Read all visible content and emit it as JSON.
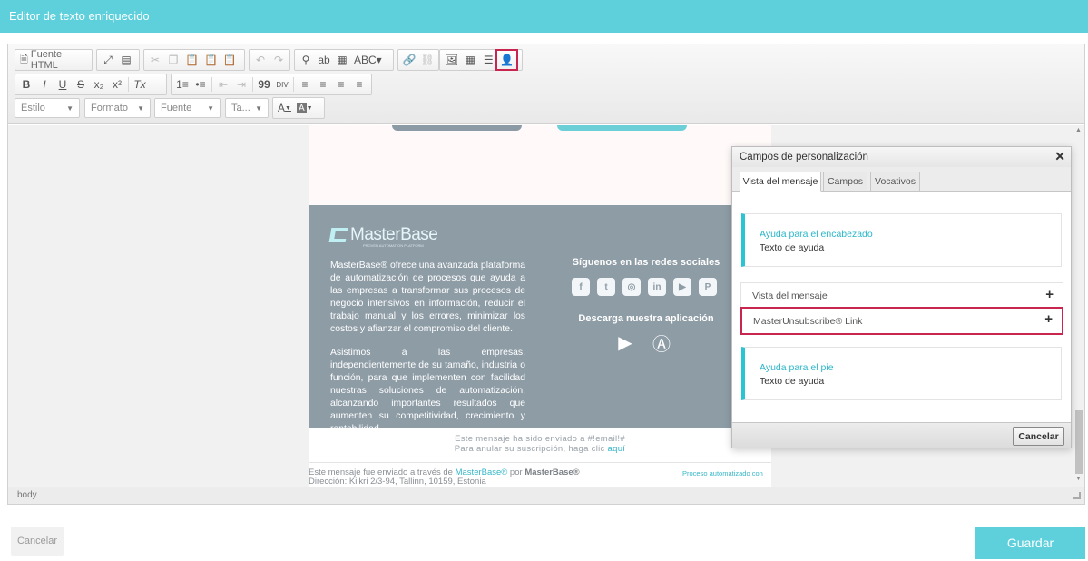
{
  "header": {
    "title": "Editor de texto enriquecido"
  },
  "toolbar": {
    "source_label": "Fuente HTML",
    "combos": {
      "style": "Estilo",
      "format": "Formato",
      "font": "Fuente",
      "size": "Ta..."
    },
    "icons": {
      "source": "document-icon",
      "maximize": "maximize-icon",
      "showblocks": "show-blocks-icon",
      "cut": "cut-icon",
      "copy": "copy-icon",
      "paste": "paste-icon",
      "paste_text": "paste-text-icon",
      "paste_word": "paste-word-icon",
      "undo": "undo-icon",
      "redo": "redo-icon",
      "find": "find-icon",
      "replace": "replace-icon",
      "select_all": "select-all-icon",
      "spellcheck": "spellcheck-icon",
      "link": "link-icon",
      "unlink": "unlink-icon",
      "image": "image-icon",
      "table": "table-icon",
      "hrule": "horizontal-rule-icon",
      "personalization": "user-icon"
    },
    "format_glyphs": {
      "bold": "B",
      "italic": "I",
      "underline": "U",
      "strike": "S",
      "subscript": "x₂",
      "superscript": "x²",
      "remove_format": "Tx",
      "numbered": "1≡",
      "bulleted": "•≡",
      "outdent": "⇤",
      "indent": "⇥",
      "blockquote": "99",
      "div": "DIV",
      "align_left": "≡",
      "align_center": "≡",
      "align_right": "≡",
      "justify": "≡",
      "text_color": "A",
      "bg_color": "A"
    }
  },
  "email": {
    "logo_text": "MasterBase",
    "logo_sub": "PROVEN AUTOMATION PLATFORM",
    "para1": "MasterBase® ofrece una avanzada plataforma de automatización de procesos que ayuda a las empresas a transformar sus procesos de negocio intensivos en información, reducir el trabajo manual y los errores, minimizar los costos y afianzar el compromiso del cliente.",
    "para2": "Asistimos a las empresas, independientemente de su tamaño, industria o función, para que implementen con facilidad nuestras soluciones de automatización, alcanzando importantes resultados que aumenten su competitividad, crecimiento y rentabilidad.",
    "social_title": "Síguenos en las redes sociales",
    "social_icons": [
      "facebook-icon",
      "twitter-icon",
      "instagram-icon",
      "linkedin-icon",
      "youtube-icon",
      "pinterest-icon"
    ],
    "social_glyphs": [
      "f",
      "t",
      "◎",
      "in",
      "▶",
      "P"
    ],
    "app_title": "Descarga nuestra aplicación",
    "app_icons": [
      "google-play-icon",
      "app-store-icon"
    ],
    "sent_line1": "Este mensaje ha sido enviado a #!email!#",
    "sent_line2_prefix": "Para anular su suscripción, haga clic ",
    "sent_line2_link": "aquí",
    "via_prefix": "Este mensaje fue enviado a través de ",
    "via_brand": "MasterBase®",
    "via_by": " por ",
    "via_company": "MasterBase®",
    "via_address": "Dirección: Kiikri 2/3-94, Tallinn, 10159, Estonia",
    "auto_badge": "Proceso automatizado con"
  },
  "statusbar": {
    "path": "body"
  },
  "dialog": {
    "title": "Campos de personalización",
    "tabs": [
      "Vista del mensaje",
      "Campos",
      "Vocativos"
    ],
    "header_card": {
      "title": "Ayuda para el encabezado",
      "subtitle": "Texto de ayuda"
    },
    "rows": [
      {
        "label": "Vista del mensaje"
      },
      {
        "label": "MasterUnsubscribe® Link"
      }
    ],
    "footer_card": {
      "title": "Ayuda para el pie",
      "subtitle": "Texto de ayuda"
    },
    "cancel_label": "Cancelar"
  },
  "actions": {
    "cancel_label": "Cancelar",
    "save_label": "Guardar"
  },
  "colors": {
    "accent": "#5dd0dc",
    "highlight": "#c8254f",
    "footer_bg": "#8e9ca6"
  }
}
